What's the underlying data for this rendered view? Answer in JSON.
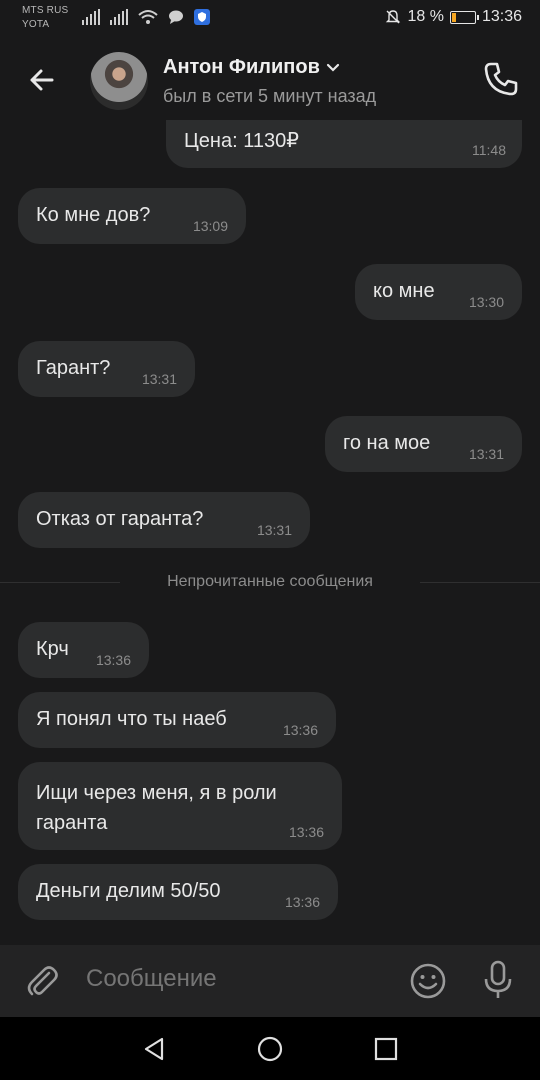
{
  "statusbar": {
    "carrier1": "MTS RUS",
    "carrier2": "YOTA",
    "battery_percent": "18 %",
    "battery_level": 0.18,
    "time": "13:36"
  },
  "header": {
    "name": "Антон Филипов",
    "status": "был в сети 5 минут назад"
  },
  "messages": [
    {
      "dir": "out",
      "text": "Цена: 1130₽",
      "time": "11:48"
    },
    {
      "dir": "in",
      "text": "Ко мне дов?",
      "time": "13:09"
    },
    {
      "dir": "out",
      "text": "ко мне",
      "time": "13:30"
    },
    {
      "dir": "in",
      "text": "Гарант?",
      "time": "13:31"
    },
    {
      "dir": "out",
      "text": "го на мое",
      "time": "13:31"
    },
    {
      "dir": "in",
      "text": "Отказ от гаранта?",
      "time": "13:31"
    },
    {
      "dir": "in",
      "text": "Крч",
      "time": "13:36"
    },
    {
      "dir": "in",
      "text": "Я понял что ты наеб",
      "time": "13:36"
    },
    {
      "dir": "in",
      "text": "Ищи через меня, я в роли гаранта",
      "time": "13:36"
    },
    {
      "dir": "in",
      "text": "Деньги делим 50/50",
      "time": "13:36"
    }
  ],
  "divider": "Непрочитанные сообщения",
  "composer": {
    "placeholder": "Сообщение"
  },
  "colors": {
    "background": "#19191a",
    "bubble": "#2c2d2e",
    "battery": "#f5a623"
  },
  "icons": [
    "back-arrow-icon",
    "chevron-down-icon",
    "phone-icon",
    "attach-icon",
    "emoji-icon",
    "mic-icon",
    "nav-back-icon",
    "nav-home-icon",
    "nav-recents-icon"
  ]
}
